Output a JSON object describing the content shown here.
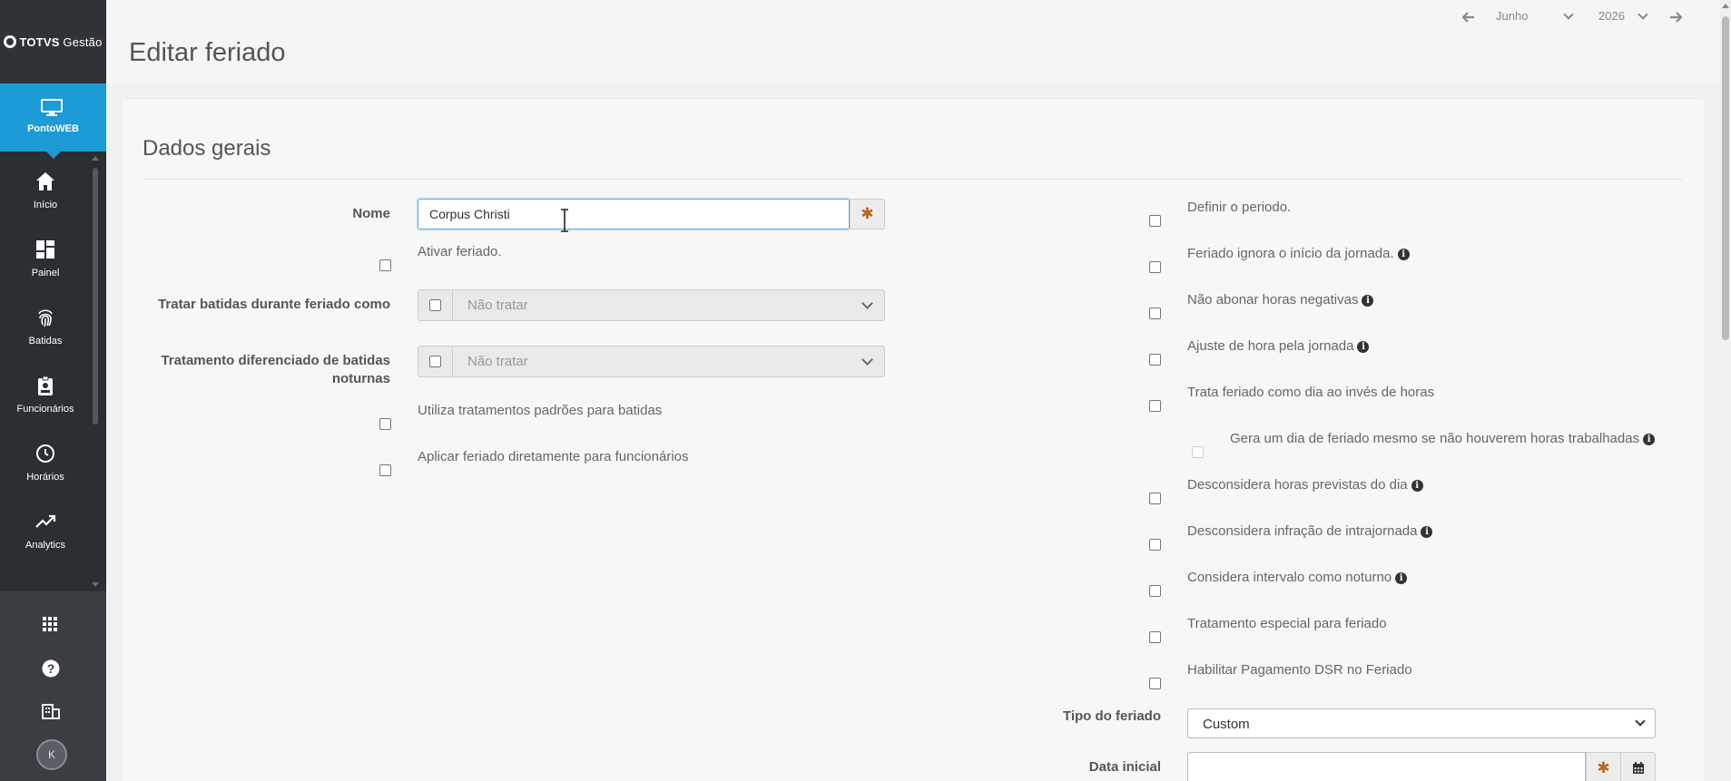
{
  "app": {
    "logo_brand": "TOTVS",
    "logo_product": "Gestão"
  },
  "module": {
    "label": "PontoWEB",
    "icon": "monitor-icon"
  },
  "nav": [
    {
      "label": "Início",
      "icon": "home-icon"
    },
    {
      "label": "Painel",
      "icon": "dashboard-icon"
    },
    {
      "label": "Batidas",
      "icon": "fingerprint-icon"
    },
    {
      "label": "Funcionários",
      "icon": "badge-icon"
    },
    {
      "label": "Horários",
      "icon": "clock-icon"
    },
    {
      "label": "Analytics",
      "icon": "trend-icon"
    }
  ],
  "sidebar_bottom": {
    "avatar_initial": "K"
  },
  "header": {
    "title": "Editar feriado",
    "month": "Junho",
    "year": "2026"
  },
  "section": {
    "title": "Dados gerais"
  },
  "form_left": {
    "nome_label": "Nome",
    "nome_value": "Corpus Christi",
    "required_marker": "✱",
    "ativar_label": "Ativar feriado.",
    "tratar_label": "Tratar batidas durante feriado como",
    "tratar_value": "Não tratar",
    "tratamento_noturno_label": "Tratamento diferenciado de batidas noturnas",
    "tratamento_noturno_value": "Não tratar",
    "utiliza_label": "Utiliza tratamentos padrões para batidas",
    "aplicar_label": "Aplicar feriado diretamente para funcionários"
  },
  "form_right": {
    "options": [
      {
        "label": "Definir o periodo.",
        "info": false
      },
      {
        "label": "Feriado ignora o início da jornada.",
        "info": true
      },
      {
        "label": "Não abonar horas negativas",
        "info": true
      },
      {
        "label": "Ajuste de hora pela jornada",
        "info": true
      },
      {
        "label": "Trata feriado como dia ao invés de horas",
        "info": false
      },
      {
        "label": "Gera um dia de feriado mesmo se não houverem horas trabalhadas",
        "info": true
      },
      {
        "label": "Desconsidera horas previstas do dia",
        "info": true
      },
      {
        "label": "Desconsidera infração de intrajornada",
        "info": true
      },
      {
        "label": "Considera intervalo como noturno",
        "info": true
      },
      {
        "label": "Tratamento especial para feriado",
        "info": false
      },
      {
        "label": "Habilitar Pagamento DSR no Feriado",
        "info": false
      }
    ],
    "tipo_label": "Tipo do feriado",
    "tipo_value": "Custom",
    "data_inicial_label": "Data inicial",
    "info_glyph": "i"
  },
  "colors": {
    "sidebar": "#2b2e33",
    "accent": "#1d9bd6",
    "required": "#b66a1e"
  }
}
